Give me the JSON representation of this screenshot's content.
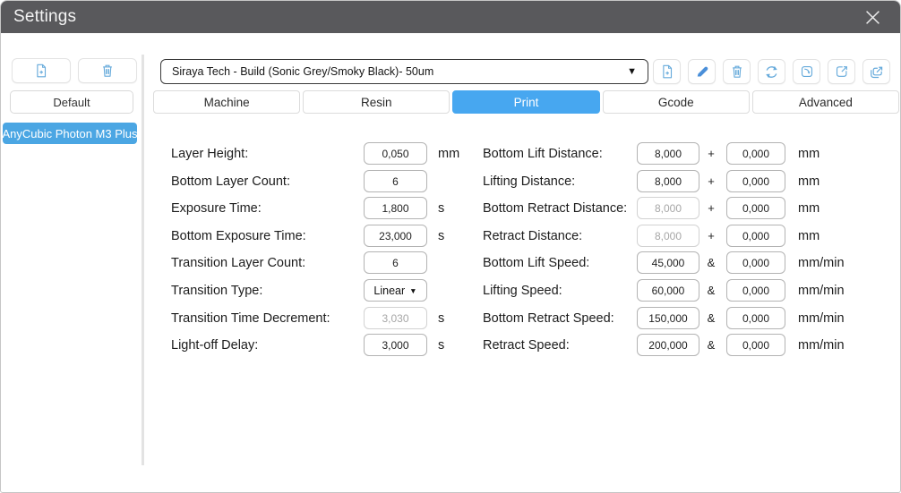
{
  "colors": {
    "titlebar_bg": "#59595c",
    "accent_blue": "#47a7f0",
    "sidebar_selected_bg": "#4ba6e3",
    "icon_blue": "#66aadb",
    "pencil_blue": "#4a8fd9"
  },
  "titlebar": {
    "title": "Settings",
    "close_icon": "x"
  },
  "sidebar": {
    "default_button": "Default",
    "machine_items": [
      {
        "label": "AnyCubic Photon M3 Plus",
        "selected": true
      }
    ]
  },
  "profile_bar": {
    "selected_profile": "Siraya Tech - Build (Sonic Grey/Smoky Black)- 50um",
    "dropdown_icon": "caret-down",
    "action_icons": [
      "add-profile",
      "edit-profile",
      "delete-profile",
      "refresh-profiles",
      "import-profile",
      "export-profile",
      "export-all-profiles"
    ]
  },
  "tabs": [
    {
      "label": "Machine",
      "active": false
    },
    {
      "label": "Resin",
      "active": false
    },
    {
      "label": "Print",
      "active": true
    },
    {
      "label": "Gcode",
      "active": false
    },
    {
      "label": "Advanced",
      "active": false
    }
  ],
  "form": {
    "left_column": [
      {
        "name": "layer-height",
        "label": "Layer Height:",
        "value": "0,050",
        "unit": "mm",
        "disabled": false
      },
      {
        "name": "bottom-layer-count",
        "label": "Bottom Layer Count:",
        "value": "6",
        "unit": "",
        "disabled": false
      },
      {
        "name": "exposure-time",
        "label": "Exposure Time:",
        "value": "1,800",
        "unit": "s",
        "disabled": false
      },
      {
        "name": "bottom-exposure-time",
        "label": "Bottom Exposure Time:",
        "value": "23,000",
        "unit": "s",
        "disabled": false
      },
      {
        "name": "transition-layer-count",
        "label": "Transition Layer Count:",
        "value": "6",
        "unit": "",
        "disabled": false
      },
      {
        "name": "transition-type",
        "label": "Transition Type:",
        "value": "Linear",
        "unit": "",
        "disabled": false,
        "type": "select"
      },
      {
        "name": "transition-time-decrement",
        "label": "Transition Time Decrement:",
        "value": "3,030",
        "unit": "s",
        "disabled": true
      },
      {
        "name": "light-off-delay",
        "label": "Light-off Delay:",
        "value": "3,000",
        "unit": "s",
        "disabled": false
      }
    ],
    "right_column": [
      {
        "name": "bottom-lift-distance",
        "label": "Bottom Lift Distance:",
        "value1": "8,000",
        "op": "+",
        "value2": "0,000",
        "unit": "mm",
        "disabled1": false
      },
      {
        "name": "lifting-distance",
        "label": "Lifting Distance:",
        "value1": "8,000",
        "op": "+",
        "value2": "0,000",
        "unit": "mm",
        "disabled1": false
      },
      {
        "name": "bottom-retract-distance",
        "label": "Bottom Retract Distance:",
        "value1": "8,000",
        "op": "+",
        "value2": "0,000",
        "unit": "mm",
        "disabled1": true
      },
      {
        "name": "retract-distance",
        "label": "Retract Distance:",
        "value1": "8,000",
        "op": "+",
        "value2": "0,000",
        "unit": "mm",
        "disabled1": true
      },
      {
        "name": "bottom-lift-speed",
        "label": "Bottom Lift Speed:",
        "value1": "45,000",
        "op": "&",
        "value2": "0,000",
        "unit": "mm/min",
        "disabled1": false
      },
      {
        "name": "lifting-speed",
        "label": "Lifting Speed:",
        "value1": "60,000",
        "op": "&",
        "value2": "0,000",
        "unit": "mm/min",
        "disabled1": false
      },
      {
        "name": "bottom-retract-speed",
        "label": "Bottom Retract Speed:",
        "value1": "150,000",
        "op": "&",
        "value2": "0,000",
        "unit": "mm/min",
        "disabled1": false
      },
      {
        "name": "retract-speed",
        "label": "Retract Speed:",
        "value1": "200,000",
        "op": "&",
        "value2": "0,000",
        "unit": "mm/min",
        "disabled1": false
      }
    ]
  }
}
